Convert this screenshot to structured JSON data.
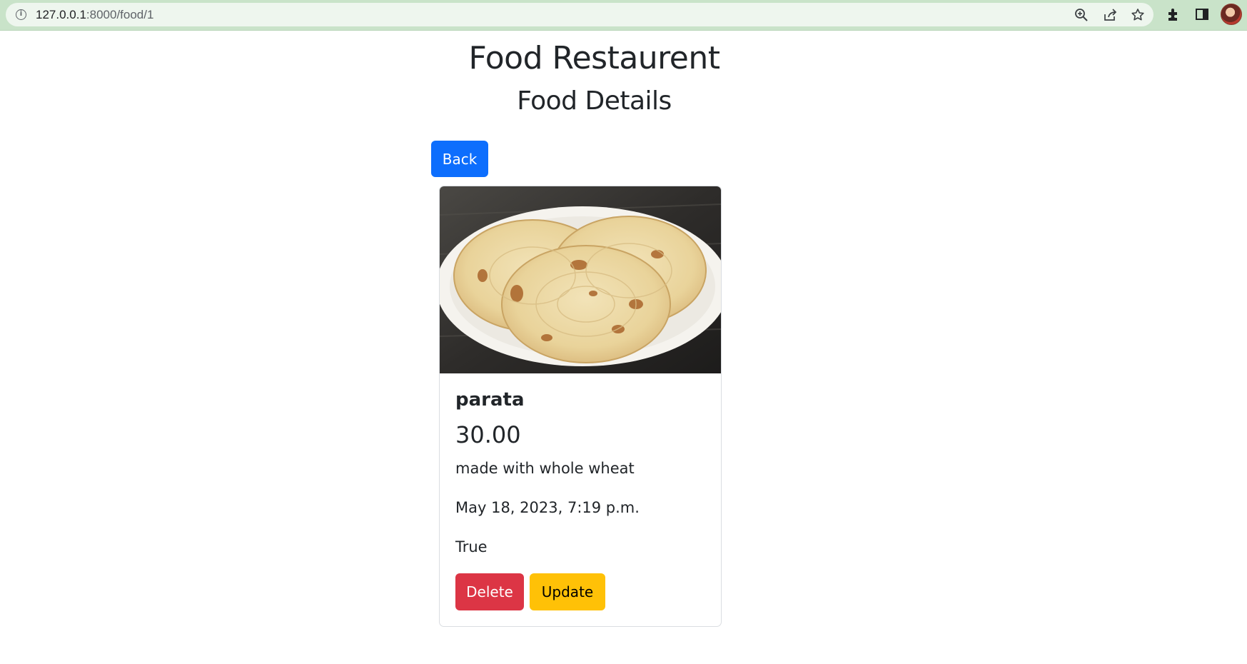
{
  "browser": {
    "url_host": "127.0.0.1",
    "url_path": ":8000/food/1",
    "icons": [
      "info-icon",
      "zoom-icon",
      "share-icon",
      "bookmark-star-icon",
      "extensions-icon",
      "side-panel-icon",
      "profile-avatar"
    ]
  },
  "page": {
    "title": "Food Restaurent",
    "subtitle": "Food Details",
    "back_label": "Back"
  },
  "food": {
    "name": "parata",
    "price": "30.00",
    "description": "made with whole wheat",
    "created": "May 18, 2023, 7:19 p.m.",
    "available": "True",
    "image": "plate-of-parata-photo"
  },
  "actions": {
    "delete_label": "Delete",
    "update_label": "Update"
  },
  "colors": {
    "primary": "#0d6efd",
    "danger": "#dc3545",
    "warning": "#ffc107",
    "browser_frame": "#c9e3c9"
  }
}
